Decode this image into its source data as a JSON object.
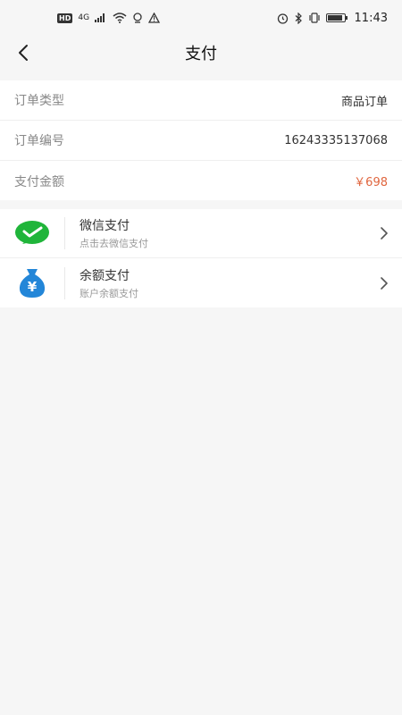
{
  "status_bar": {
    "hd": "HD",
    "signal_label": "4G",
    "time": "11:43",
    "battery_level": 0.9,
    "icons": [
      "signal-icon",
      "wifi-icon",
      "hotspot-icon",
      "alert-icon",
      "alarm-icon",
      "bluetooth-icon",
      "vibrate-icon",
      "battery-icon"
    ]
  },
  "navbar": {
    "back_icon": "chevron-left-icon",
    "title": "支付"
  },
  "order_info": {
    "rows": [
      {
        "label": "订单类型",
        "value": "商品订单"
      },
      {
        "label": "订单编号",
        "value": "16243335137068"
      },
      {
        "label": "支付金额",
        "value": "￥698"
      }
    ],
    "amount_color": "#e0663f"
  },
  "payment_methods": [
    {
      "title": "微信支付",
      "subtitle": "点击去微信支付",
      "icon": "wechat-icon",
      "color": "#20b53a"
    },
    {
      "title": "余额支付",
      "subtitle": "账户余额支付",
      "icon": "money-bag-icon",
      "symbol": "¥",
      "color": "#2386d8"
    }
  ]
}
